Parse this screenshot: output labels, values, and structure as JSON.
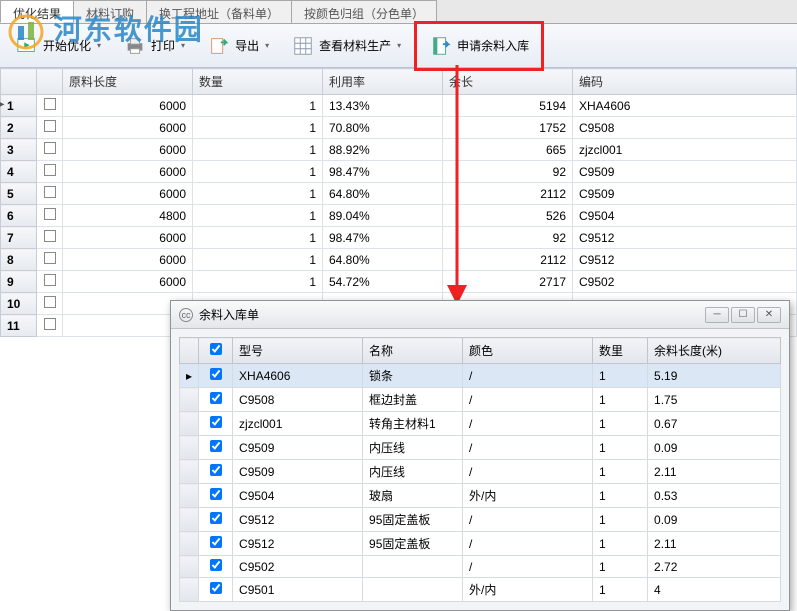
{
  "watermark": "河东软件园",
  "tabs": [
    {
      "label": "优化结果",
      "active": true
    },
    {
      "label": "材料订购",
      "active": false
    },
    {
      "label": "换工程地址（备料单）",
      "active": false
    },
    {
      "label": "按颜色归组（分色单）",
      "active": false
    }
  ],
  "toolbar": {
    "start_optimize": "开始优化",
    "print": "打印",
    "export": "导出",
    "view_material_prod": "查看材料生产",
    "apply_remnant": "申请余料入库"
  },
  "main_grid": {
    "headers": [
      "",
      "",
      "原料长度",
      "数量",
      "利用率",
      "余长",
      "编码"
    ],
    "rows": [
      {
        "n": "1",
        "len": 6000,
        "qty": 1,
        "rate": "13.43%",
        "rem": 5194,
        "code": "XHA4606"
      },
      {
        "n": "2",
        "len": 6000,
        "qty": 1,
        "rate": "70.80%",
        "rem": 1752,
        "code": "C9508"
      },
      {
        "n": "3",
        "len": 6000,
        "qty": 1,
        "rate": "88.92%",
        "rem": 665,
        "code": "zjzcl001"
      },
      {
        "n": "4",
        "len": 6000,
        "qty": 1,
        "rate": "98.47%",
        "rem": 92,
        "code": "C9509"
      },
      {
        "n": "5",
        "len": 6000,
        "qty": 1,
        "rate": "64.80%",
        "rem": 2112,
        "code": "C9509"
      },
      {
        "n": "6",
        "len": 4800,
        "qty": 1,
        "rate": "89.04%",
        "rem": 526,
        "code": "C9504"
      },
      {
        "n": "7",
        "len": 6000,
        "qty": 1,
        "rate": "98.47%",
        "rem": 92,
        "code": "C9512"
      },
      {
        "n": "8",
        "len": 6000,
        "qty": 1,
        "rate": "64.80%",
        "rem": 2112,
        "code": "C9512"
      },
      {
        "n": "9",
        "len": 6000,
        "qty": 1,
        "rate": "54.72%",
        "rem": 2717,
        "code": "C9502"
      },
      {
        "n": "10",
        "len": "",
        "qty": "",
        "rate": "",
        "rem": "",
        "code": ""
      },
      {
        "n": "11",
        "len": "",
        "qty": "",
        "rate": "",
        "rem": "",
        "code": ""
      }
    ]
  },
  "dialog": {
    "title": "余料入库单",
    "headers": [
      "",
      "",
      "型号",
      "名称",
      "颜色",
      "数里",
      "余料长度(米)"
    ],
    "rows": [
      {
        "model": "XHA4606",
        "name": "锁条",
        "color": "/",
        "qty": 1,
        "len": 5.19,
        "sel": true
      },
      {
        "model": "C9508",
        "name": "框边封盖",
        "color": "/",
        "qty": 1,
        "len": 1.75
      },
      {
        "model": "zjzcl001",
        "name": "转角主材料1",
        "color": "/",
        "qty": 1,
        "len": 0.67
      },
      {
        "model": "C9509",
        "name": "内压线",
        "color": "/",
        "qty": 1,
        "len": 0.09
      },
      {
        "model": "C9509",
        "name": "内压线",
        "color": "/",
        "qty": 1,
        "len": 2.11
      },
      {
        "model": "C9504",
        "name": "玻扇",
        "color": "外/内",
        "qty": 1,
        "len": 0.53
      },
      {
        "model": "C9512",
        "name": "95固定盖板",
        "color": "/",
        "qty": 1,
        "len": 0.09
      },
      {
        "model": "C9512",
        "name": "95固定盖板",
        "color": "/",
        "qty": 1,
        "len": 2.11
      },
      {
        "model": "C9502",
        "name": "",
        "color": "/",
        "qty": 1,
        "len": 2.72
      },
      {
        "model": "C9501",
        "name": "",
        "color": "外/内",
        "qty": 1,
        "len": 4
      }
    ]
  }
}
